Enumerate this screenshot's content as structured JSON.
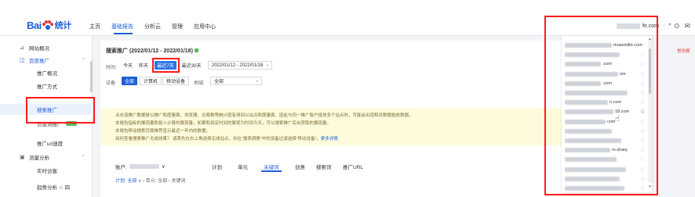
{
  "header": {
    "logo_text": "Bai",
    "logo_sub": "统计",
    "nav": [
      "主页",
      "基础报告",
      "分析云",
      "管理",
      "应用中心"
    ],
    "account_suffix": "fe.com",
    "icons": [
      "help-icon",
      "message-icon"
    ]
  },
  "sidebar": {
    "items": [
      {
        "label": "网站概况",
        "icon": "dashboard-icon"
      },
      {
        "label": "百度推广",
        "icon": "megaphone-icon"
      },
      {
        "label": "推广概况"
      },
      {
        "label": "推广方式"
      },
      {
        "label": "搜索推广"
      },
      {
        "label": "信息流推广"
      },
      {
        "label": "推广url速度"
      },
      {
        "label": "流量分析",
        "icon": "chart-icon"
      },
      {
        "label": "实时访客"
      },
      {
        "label": "趋势分析 ☆ 四"
      }
    ]
  },
  "report": {
    "title": "搜索推广 (2022/01/12 - 2022/01/18)",
    "time_label": "时间:",
    "time_buttons": [
      "今天",
      "昨天",
      "最近7天",
      "最近30天"
    ],
    "date_range": "2022/01/12 - 2022/01/18",
    "device_label": "设备:",
    "device_buttons": [
      "全部",
      "计算机",
      "移动设备"
    ],
    "region_label": "地域:",
    "region_value": "全部",
    "right_hint": "常用报"
  },
  "notice": {
    "lines": [
      "点击该推广数据是以推广和度量面、浏览器、访客数等统计层有排到以站点和度量面、因此与同一推广账户投放多个站点时，可能会出现和总数据投放数据。",
      "本报告指标的展现量和投入计算的展现量，如果和设定时间的展现为时间今天，可以搜索推广后台获取的展现量。",
      "本报告移动搜索页面推荐显示最近一年内的数据。",
      "如何查看搜索推广无成效果？ 请首先在右上角选择无成站点，并在“报表洞察”中的设备过滤选择“移动设备”。"
    ],
    "link": "更多详情"
  },
  "table_tabs": {
    "account_label": "账户:",
    "tabs": [
      "计划",
      "单元",
      "关键词",
      "创意",
      "搜索词",
      "推广URL"
    ],
    "filter_text": "计划: 全部",
    "filter_unit": "单元: 全部",
    "filter_kw": "关键词"
  },
  "account_dropdown": {
    "rows": [
      {
        "suffix": "museinlife.com",
        "w": 60
      },
      {
        "suffix": "",
        "w": 70
      },
      {
        "suffix": ".com",
        "w": 46
      },
      {
        "suffix": "om",
        "w": 68
      },
      {
        "suffix": ".com",
        "w": 46
      },
      {
        "suffix": "",
        "w": 80
      },
      {
        "suffix": "n.com",
        "w": 55
      },
      {
        "suffix": "18.com",
        "w": 62
      },
      {
        "suffix": "com",
        "w": 52
      },
      {
        "suffix": "",
        "w": 60
      },
      {
        "suffix": "",
        "w": 72
      },
      {
        "suffix": "m-zhaoj",
        "w": 58
      },
      {
        "suffix": "",
        "w": 66
      },
      {
        "suffix": "",
        "w": 78
      },
      {
        "suffix": "",
        "w": 70
      },
      {
        "suffix": "",
        "w": 76
      }
    ]
  },
  "colors": {
    "accent": "#1e5fd6",
    "highlight": "#ff1a1a",
    "notice_bg": "#fdfbdc",
    "badge_green": "#5cb85c"
  }
}
